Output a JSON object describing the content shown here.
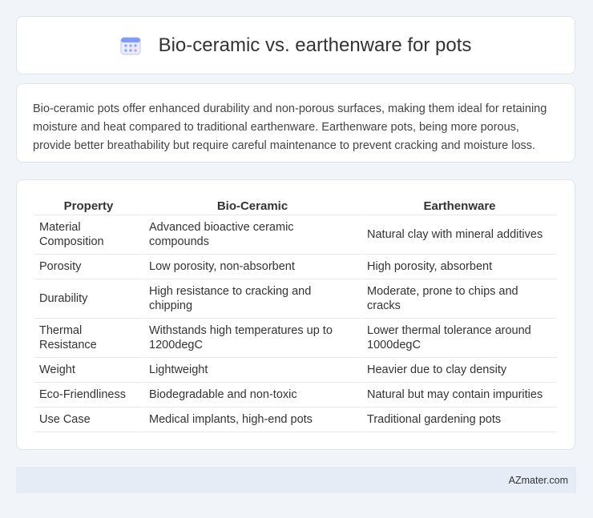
{
  "header": {
    "title": "Bio-ceramic vs. earthenware for pots",
    "icon": "calendar-grid-icon"
  },
  "intro": {
    "text": "Bio-ceramic pots offer enhanced durability and non-porous surfaces, making them ideal for retaining moisture and heat compared to traditional earthenware. Earthenware pots, being more porous, provide better breathability but require careful maintenance to prevent cracking and moisture loss."
  },
  "table": {
    "headers": [
      "Property",
      "Bio-Ceramic",
      "Earthenware"
    ],
    "rows": [
      [
        "Material Composition",
        "Advanced bioactive ceramic compounds",
        "Natural clay with mineral additives"
      ],
      [
        "Porosity",
        "Low porosity, non-absorbent",
        "High porosity, absorbent"
      ],
      [
        "Durability",
        "High resistance to cracking and chipping",
        "Moderate, prone to chips and cracks"
      ],
      [
        "Thermal Resistance",
        "Withstands high temperatures up to 1200degC",
        "Lower thermal tolerance around 1000degC"
      ],
      [
        "Weight",
        "Lightweight",
        "Heavier due to clay density"
      ],
      [
        "Eco-Friendliness",
        "Biodegradable and non-toxic",
        "Natural but may contain impurities"
      ],
      [
        "Use Case",
        "Medical implants, high-end pots",
        "Traditional gardening pots"
      ]
    ]
  },
  "footer": {
    "brand": "AZmater.com"
  },
  "colors": {
    "accent": "#6b8cff",
    "background": "#f1f4f9",
    "footer": "#e5ecf6"
  }
}
